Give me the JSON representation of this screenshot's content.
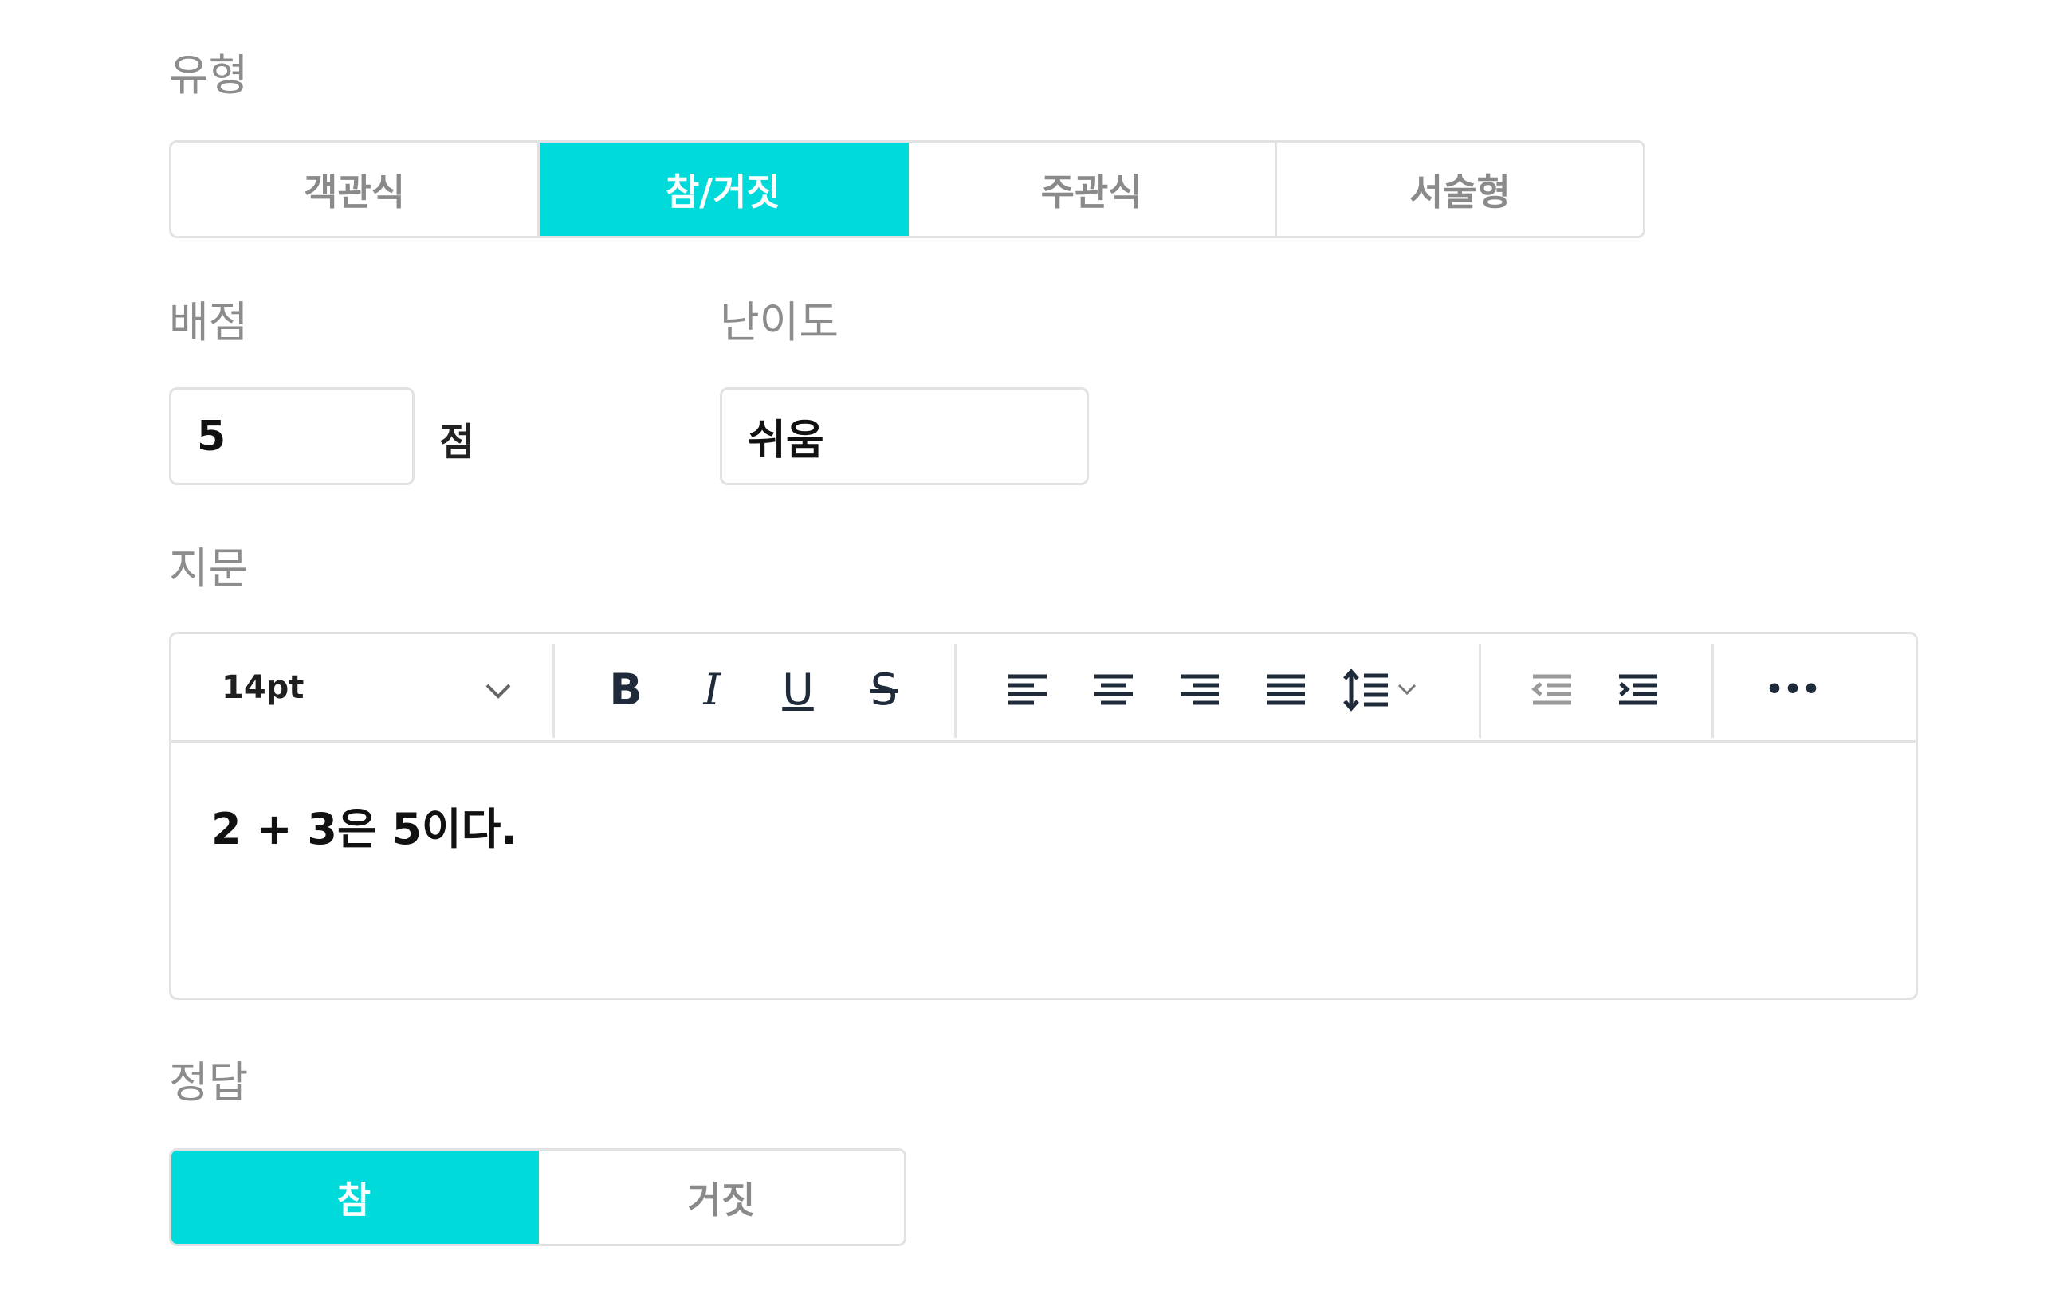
{
  "type_section": {
    "label": "유형",
    "options": [
      "객관식",
      "참/거짓",
      "주관식",
      "서술형"
    ],
    "selected": "참/거짓"
  },
  "score_section": {
    "label": "배점",
    "value": "5",
    "unit": "점"
  },
  "difficulty_section": {
    "label": "난이도",
    "value": "쉬움"
  },
  "passage_section": {
    "label": "지문",
    "toolbar": {
      "font_size": "14pt",
      "bold": "B",
      "italic": "I",
      "underline": "U",
      "strike": "S",
      "more": "•••"
    },
    "content": "2 + 3은 5이다."
  },
  "answer_section": {
    "label": "정답",
    "options": [
      "참",
      "거짓"
    ],
    "selected": "참"
  },
  "colors": {
    "accent": "#00dada",
    "label": "#8c8c8c",
    "border": "#e2e2e2"
  }
}
